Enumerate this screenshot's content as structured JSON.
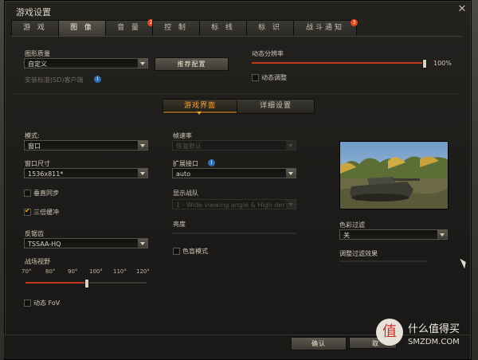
{
  "window": {
    "title": "游戏设置",
    "close_glyph": "✕"
  },
  "tabs": [
    {
      "label": "游 戏",
      "badge": ""
    },
    {
      "label": "图 像",
      "badge": "",
      "active": true
    },
    {
      "label": "音 量",
      "badge": "2"
    },
    {
      "label": "控 制",
      "badge": ""
    },
    {
      "label": "标 线",
      "badge": ""
    },
    {
      "label": "标 识",
      "badge": ""
    },
    {
      "label": "战斗通知",
      "badge": "3"
    }
  ],
  "graphics": {
    "quality_label": "图形质量",
    "quality_value": "自定义",
    "recommend_button": "推荐配置",
    "sd_client_label": "安装标准(SD)客户端",
    "dynamic_res_label": "动态分辨率",
    "dynamic_res_value": "100%",
    "dynamic_res_fraction": 1.0,
    "dynamic_adjust_label": "动态调整"
  },
  "subtabs": {
    "game_ui": "游戏界面",
    "details": "详细设置"
  },
  "left": {
    "mode_label": "模式:",
    "mode_value": "窗口",
    "window_size_label": "窗口尺寸",
    "window_size_value": "1536x811*",
    "vsync_label": "垂直同步",
    "triple_buffer_label": "三倍缓冲",
    "aa_label": "反锯齿",
    "aa_value": "TSSAA-HQ",
    "fov_label": "战场视野",
    "fov_ticks": [
      "70°",
      "80°",
      "90°",
      "100°",
      "110°",
      "120°"
    ],
    "fov_value": 95,
    "dynamic_fov_label": "动态 FoV"
  },
  "middle": {
    "fps_label": "帧速率",
    "fps_value": "恢复默认",
    "ext_label": "扩展接口",
    "ext_value": "auto",
    "display_label": "显示战队",
    "display_value": "1 - Wide viewing angle & High densi",
    "brightness_label": "亮度",
    "colorblind_label": "色盲模式"
  },
  "right": {
    "color_filter_label": "色彩过滤",
    "color_filter_value": "关",
    "filter_strength_label": "调整过滤效果"
  },
  "footer": {
    "confirm": "确认",
    "cancel_partial": "取"
  },
  "watermark": {
    "text": "什么值得买",
    "sub": "SMZDM.COM",
    "glyph": "值"
  },
  "colors": {
    "accent": "#f2a43a",
    "slider": "#c03a1e",
    "badge": "#e04a1e",
    "info": "#2c6fb6"
  }
}
